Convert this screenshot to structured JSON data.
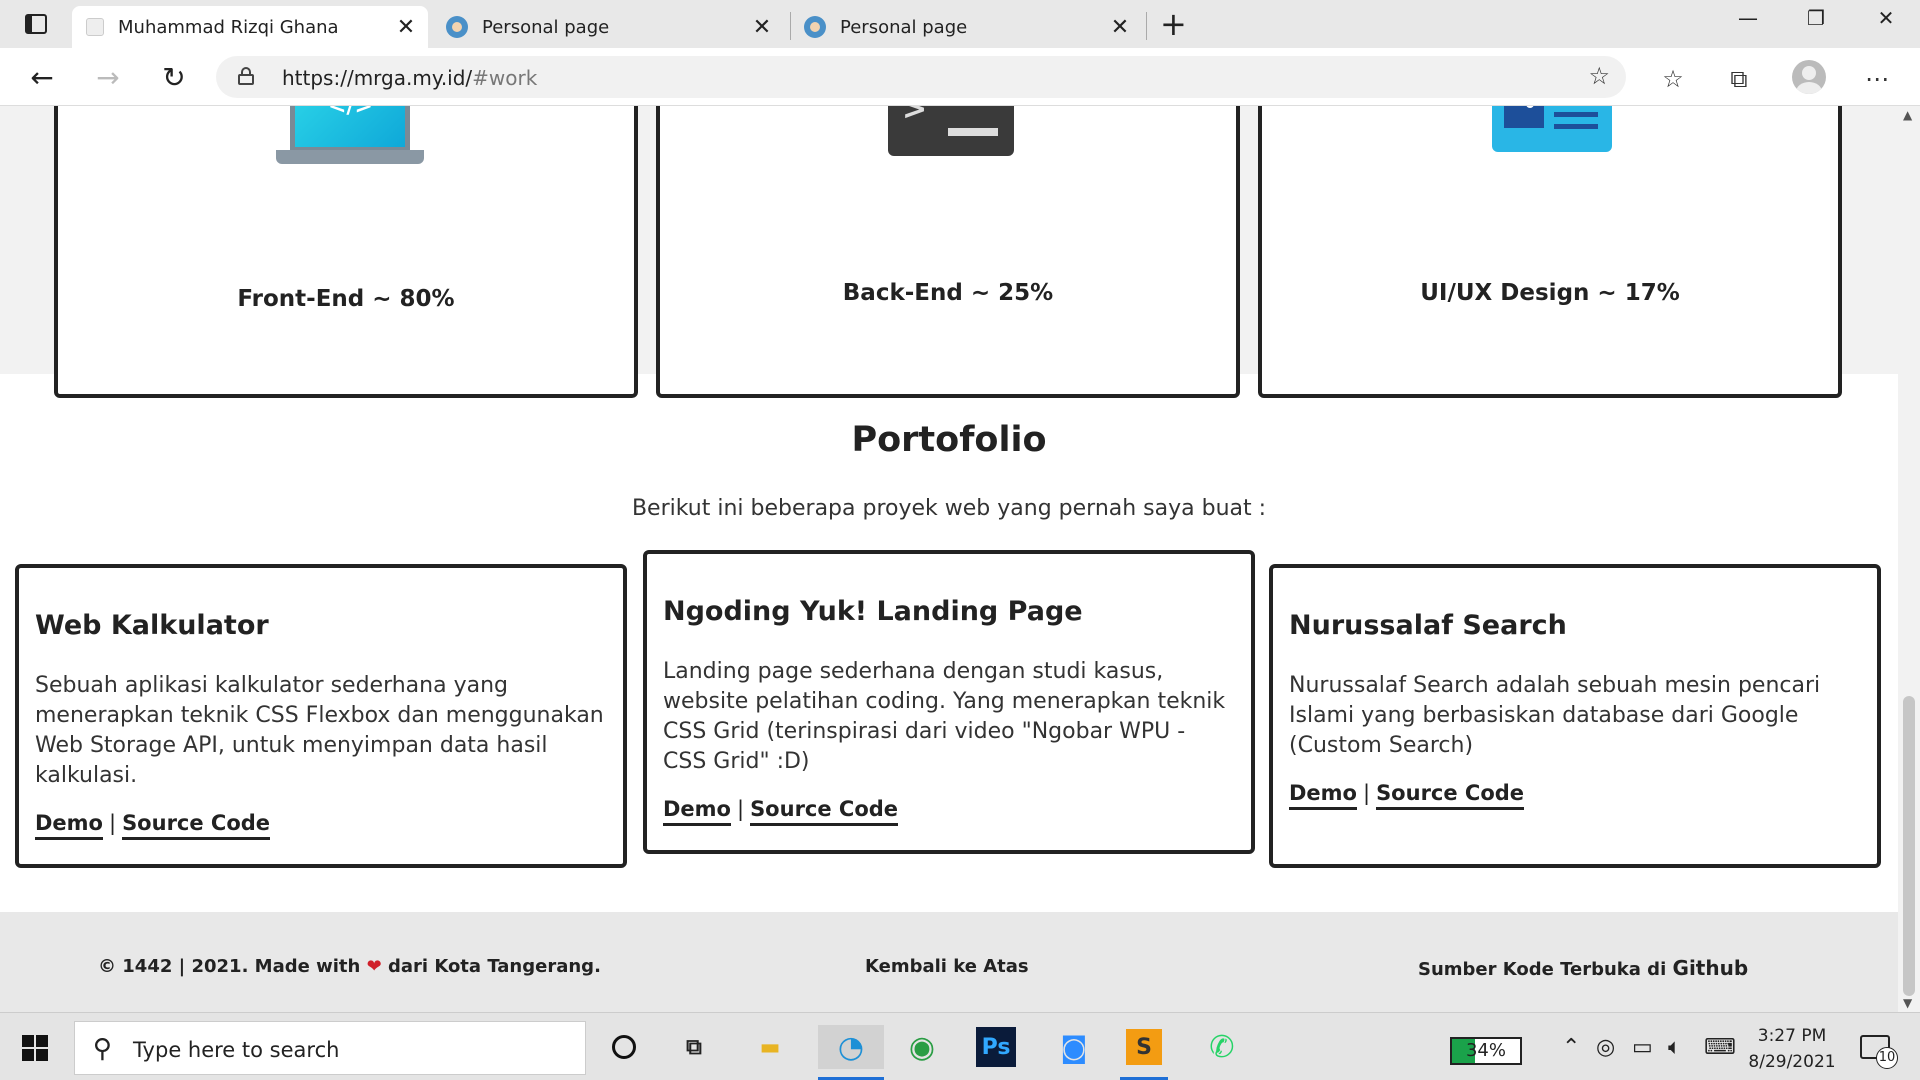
{
  "browser": {
    "tabs": [
      {
        "title": "Muhammad Rizqi Ghana",
        "active": true
      },
      {
        "title": "Personal page",
        "active": false
      },
      {
        "title": "Personal page",
        "active": false
      }
    ],
    "url_host": "https://mrga.my.id/",
    "url_hash": "#work"
  },
  "skills": [
    {
      "label": "Front-End ~ 80%",
      "icon": "laptop-code-icon",
      "percent": 80
    },
    {
      "label": "Back-End ~ 25%",
      "icon": "terminal-icon",
      "percent": 25
    },
    {
      "label": "UI/UX Design ~ 17%",
      "icon": "design-layout-icon",
      "percent": 17
    }
  ],
  "portfolio": {
    "title": "Portofolio",
    "subtitle": "Berikut ini beberapa proyek web yang pernah saya buat :",
    "projects": [
      {
        "title": "Web Kalkulator",
        "description": "Sebuah aplikasi kalkulator sederhana yang menerapkan teknik CSS Flexbox dan menggunakan Web Storage API, untuk menyimpan data hasil kalkulasi.",
        "demo": "Demo",
        "source": "Source Code"
      },
      {
        "title": "Ngoding Yuk! Landing Page",
        "description": "Landing page sederhana dengan studi kasus, website pelatihan coding. Yang menerapkan teknik CSS Grid (terinspirasi dari video \"Ngobar WPU - CSS Grid\" :D)",
        "demo": "Demo",
        "source": "Source Code"
      },
      {
        "title": "Nurussalaf Search",
        "description": "Nurussalaf Search adalah sebuah mesin pencari Islami yang berbasiskan database dari Google (Custom Search)",
        "demo": "Demo",
        "source": "Source Code"
      }
    ]
  },
  "footer": {
    "copyright_prefix": "© 1442 | 2021. Made with",
    "copyright_suffix": "dari Kota Tangerang.",
    "back_to_top": "Kembali ke Atas",
    "open_source_prefix": "Sumber Kode Terbuka di",
    "open_source_link": "Github"
  },
  "taskbar": {
    "search_placeholder": "Type here to search",
    "battery": "34%",
    "time": "3:27 PM",
    "date": "8/29/2021",
    "notifications": "10"
  },
  "colors": {
    "accent": "#1e6fd6",
    "heart": "#d0202a",
    "battery_fill": "#1aa24a"
  }
}
